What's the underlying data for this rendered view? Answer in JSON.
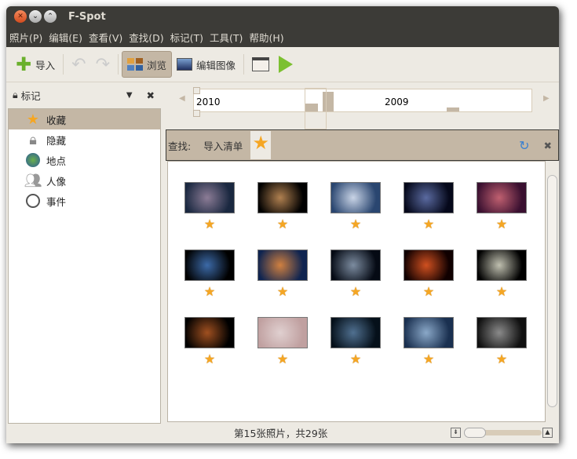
{
  "window": {
    "title": "F-Spot"
  },
  "menu": [
    "照片(P)",
    "编辑(E)",
    "查看(V)",
    "查找(D)",
    "标记(T)",
    "工具(T)",
    "帮助(H)"
  ],
  "toolbar": {
    "import": "导入",
    "browse": "浏览",
    "edit_image": "编辑图像"
  },
  "sidebar": {
    "header": "标记",
    "items": [
      {
        "label": "收藏",
        "icon": "star-icon",
        "selected": true
      },
      {
        "label": "隐藏",
        "icon": "lock-icon"
      },
      {
        "label": "地点",
        "icon": "globe-icon"
      },
      {
        "label": "人像",
        "icon": "people-icon"
      },
      {
        "label": "事件",
        "icon": "clock-icon"
      }
    ]
  },
  "timeline": {
    "years": [
      "2010",
      "2009"
    ]
  },
  "findbar": {
    "label": "查找:",
    "tag": "导入清单"
  },
  "photos": [
    {
      "c1": "#1a2840",
      "c2": "#8c7c96",
      "rated": true
    },
    {
      "c1": "#000",
      "c2": "#b08050",
      "rated": true
    },
    {
      "c1": "#2a4670",
      "c2": "#c9d4e6",
      "rated": true
    },
    {
      "c1": "#05081a",
      "c2": "#5a6aa0",
      "rated": true
    },
    {
      "c1": "#3a1030",
      "c2": "#c06070",
      "rated": true
    },
    {
      "c1": "#000",
      "c2": "#3c6aa8",
      "rated": true
    },
    {
      "c1": "#0f2450",
      "c2": "#d08040",
      "rated": true
    },
    {
      "c1": "#050a14",
      "c2": "#7c8ca0",
      "rated": true
    },
    {
      "c1": "#100000",
      "c2": "#d05020",
      "rated": true
    },
    {
      "c1": "#000",
      "c2": "#c0c0b0",
      "rated": true
    },
    {
      "c1": "#000",
      "c2": "#a05020",
      "rated": true
    },
    {
      "c1": "#c0a0a0",
      "c2": "#e0d0d0",
      "rated": true
    },
    {
      "c1": "#05101a",
      "c2": "#507090",
      "rated": true
    },
    {
      "c1": "#1a3050",
      "c2": "#8aa8c8",
      "rated": true
    },
    {
      "c1": "#101010",
      "c2": "#8a8a8a",
      "rated": true
    }
  ],
  "status": {
    "text": "第15张照片，共29张"
  }
}
